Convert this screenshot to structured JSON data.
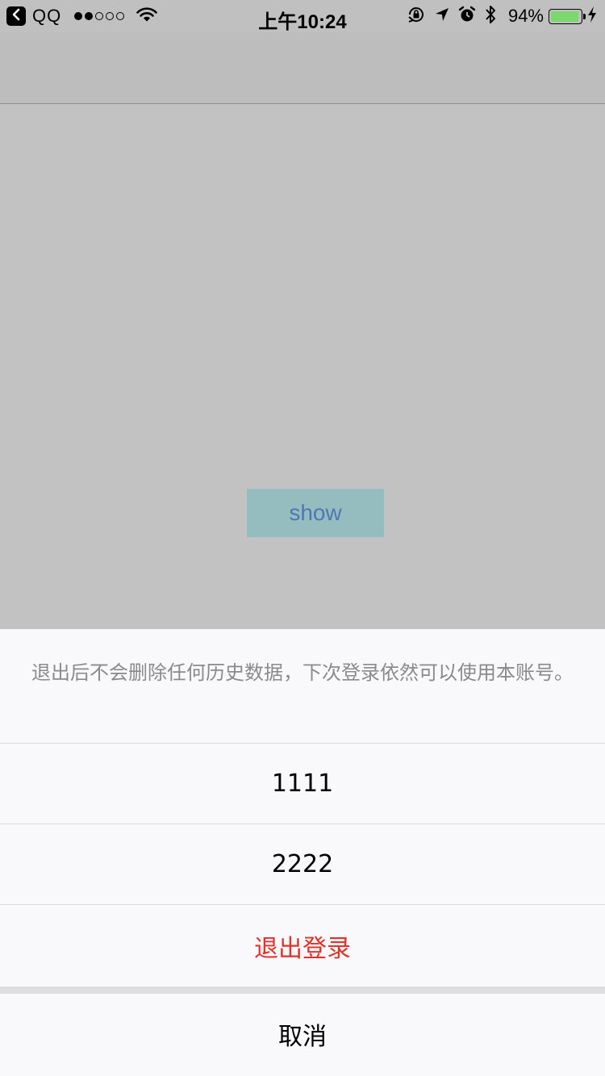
{
  "status_bar": {
    "back_app": "QQ",
    "signal_dots_filled": 2,
    "signal_dots_total": 5,
    "time": "上午10:24",
    "battery_percent": "94%",
    "battery_level": 0.94,
    "battery_fill_color": "#7bd86f",
    "icons": [
      "back-arrow-icon",
      "wifi-icon",
      "orientation-lock-icon",
      "location-arrow-icon",
      "alarm-icon",
      "bluetooth-icon",
      "battery-icon",
      "charging-bolt-icon"
    ]
  },
  "main": {
    "show_button_label": "show",
    "background_color": "#c2c2c2",
    "button_color": "#95bdbf",
    "button_text_color": "#4f77b4"
  },
  "action_sheet": {
    "message": "退出后不会删除任何历史数据，下次登录依然可以使用本账号。",
    "items": [
      {
        "label": "1111",
        "style": "default"
      },
      {
        "label": "2222",
        "style": "default"
      },
      {
        "label": "退出登录",
        "style": "destructive"
      }
    ],
    "cancel_label": "取消",
    "destructive_color": "#e0322b",
    "background_color": "#f9f9fb"
  }
}
